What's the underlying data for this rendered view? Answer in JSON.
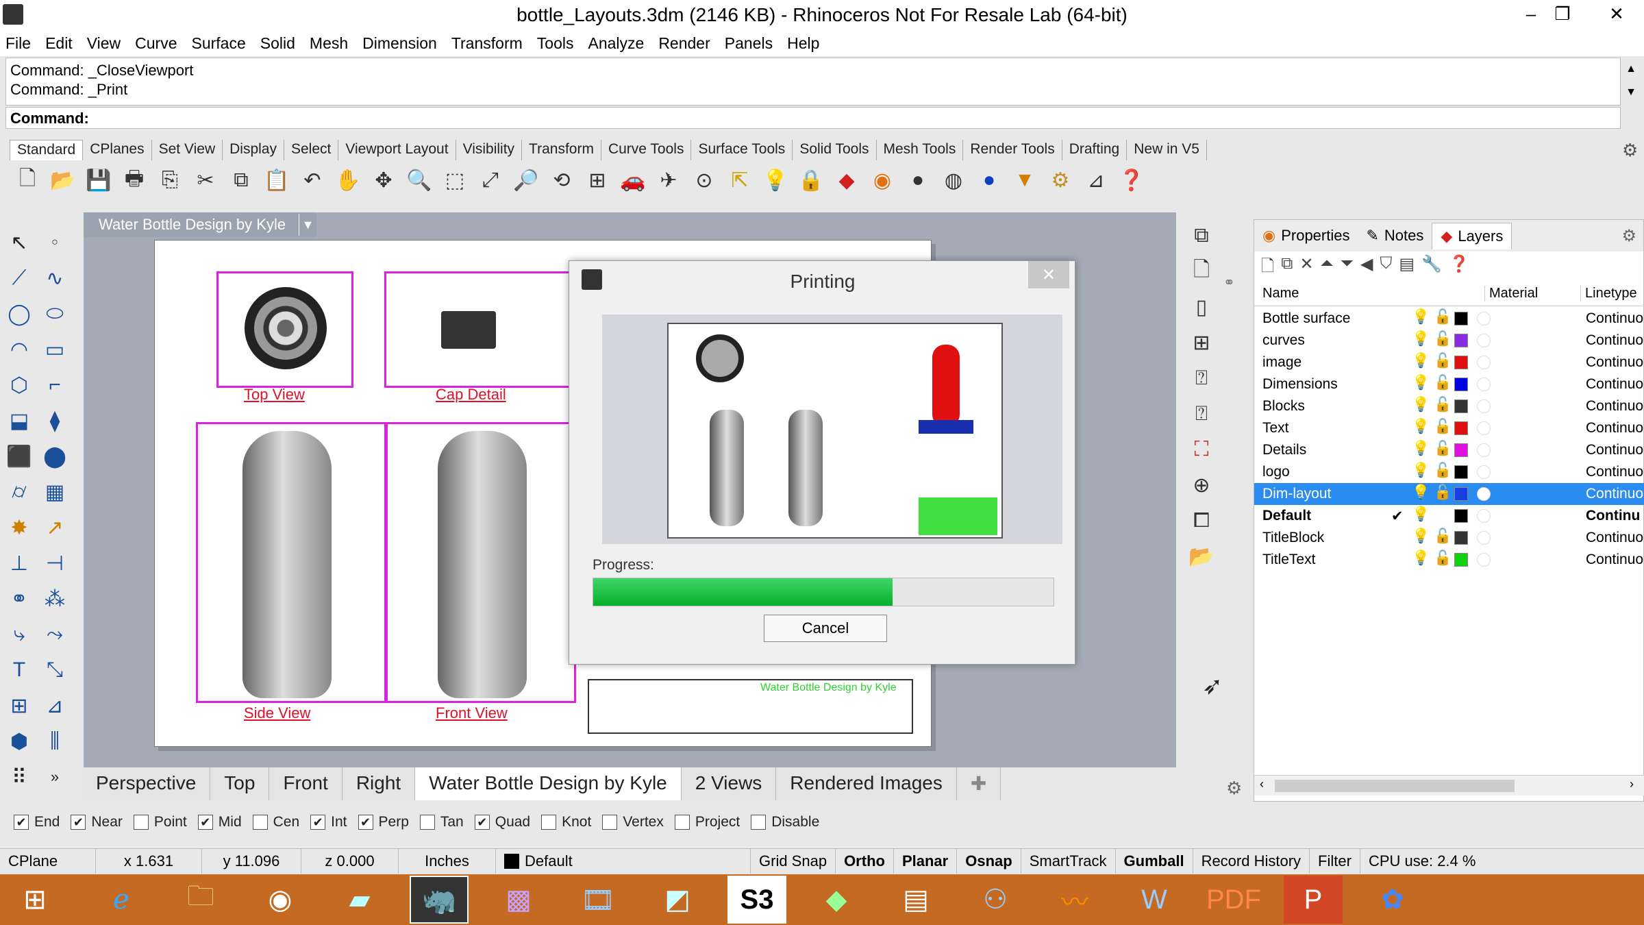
{
  "window": {
    "title": "bottle_Layouts.3dm (2146 KB) - Rhinoceros Not For Resale Lab (64-bit)",
    "min": "–",
    "restore": "❐",
    "close": "✕"
  },
  "menu": [
    "File",
    "Edit",
    "View",
    "Curve",
    "Surface",
    "Solid",
    "Mesh",
    "Dimension",
    "Transform",
    "Tools",
    "Analyze",
    "Render",
    "Panels",
    "Help"
  ],
  "command": {
    "history1": "Command: _CloseViewport",
    "history2": "Command: _Print",
    "prompt": "Command:"
  },
  "toolbar_tabs": [
    "Standard",
    "CPlanes",
    "Set View",
    "Display",
    "Select",
    "Viewport Layout",
    "Visibility",
    "Transform",
    "Curve Tools",
    "Surface Tools",
    "Solid Tools",
    "Mesh Tools",
    "Render Tools",
    "Drafting",
    "New in V5"
  ],
  "viewport": {
    "title": "Water Bottle Design by Kyle",
    "labels": {
      "top": "Top View",
      "cap": "Cap Detail",
      "side": "Side View",
      "front": "Front View",
      "titleblock": "Water Bottle Design by Kyle"
    }
  },
  "dialog": {
    "title": "Printing",
    "progress_label": "Progress:",
    "progress": 0.65,
    "cancel": "Cancel"
  },
  "panel": {
    "tabs": [
      "Properties",
      "Notes",
      "Layers"
    ],
    "columns": [
      "Name",
      "Material",
      "Linetype"
    ],
    "layers": [
      {
        "name": "Bottle surface",
        "color": "#000000",
        "linetype": "Continuou"
      },
      {
        "name": "curves",
        "color": "#8a2be2",
        "linetype": "Continuou"
      },
      {
        "name": "image",
        "color": "#e01010",
        "linetype": "Continuou"
      },
      {
        "name": "Dimensions",
        "color": "#0000e0",
        "linetype": "Continuou"
      },
      {
        "name": "Blocks",
        "color": "#333333",
        "linetype": "Continuou"
      },
      {
        "name": "Text",
        "color": "#e01010",
        "linetype": "Continuou"
      },
      {
        "name": "Details",
        "color": "#e010e0",
        "linetype": "Continuou"
      },
      {
        "name": "logo",
        "color": "#000000",
        "linetype": "Continuou"
      },
      {
        "name": "Dim-layout",
        "color": "#1a3fe0",
        "linetype": "Continuou"
      },
      {
        "name": "Default",
        "color": "#000000",
        "linetype": "Continu",
        "current": "✔"
      },
      {
        "name": "TitleBlock",
        "color": "#333333",
        "linetype": "Continuou"
      },
      {
        "name": "TitleText",
        "color": "#10d010",
        "linetype": "Continuou"
      }
    ]
  },
  "bottom_tabs": [
    "Perspective",
    "Top",
    "Front",
    "Right",
    "Water Bottle Design by Kyle",
    "2 Views",
    "Rendered Images"
  ],
  "osnap": [
    {
      "label": "End",
      "checked": true
    },
    {
      "label": "Near",
      "checked": true
    },
    {
      "label": "Point",
      "checked": false
    },
    {
      "label": "Mid",
      "checked": true
    },
    {
      "label": "Cen",
      "checked": false
    },
    {
      "label": "Int",
      "checked": true
    },
    {
      "label": "Perp",
      "checked": true
    },
    {
      "label": "Tan",
      "checked": false
    },
    {
      "label": "Quad",
      "checked": true
    },
    {
      "label": "Knot",
      "checked": false
    },
    {
      "label": "Vertex",
      "checked": false
    },
    {
      "label": "Project",
      "checked": false
    },
    {
      "label": "Disable",
      "checked": false
    }
  ],
  "status": {
    "cplane": "CPlane",
    "x": "x 1.631",
    "y": "y 11.096",
    "z": "z 0.000",
    "units": "Inches",
    "layer": "Default",
    "gridsnap": "Grid Snap",
    "ortho": "Ortho",
    "planar": "Planar",
    "osnap": "Osnap",
    "smarttrack": "SmartTrack",
    "gumball": "Gumball",
    "history": "Record History",
    "filter": "Filter",
    "cpu": "CPU use: 2.4 %"
  }
}
